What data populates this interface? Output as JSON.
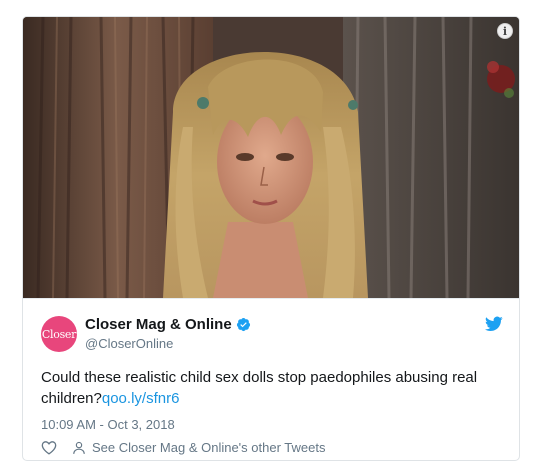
{
  "tweet": {
    "author": {
      "display_name": "Closer Mag & Online",
      "handle": "@CloserOnline",
      "avatar_text": "Closer",
      "verified": true,
      "avatar_color": "#e8467c"
    },
    "text": "Could these realistic child sex dolls stop paedophiles abusing real children?",
    "link": "qoo.ly/sfnr6",
    "timestamp": "10:09 AM - Oct 3, 2018",
    "see_other_label": "See Closer Mag & Online's other Tweets"
  },
  "media": {
    "info_icon": "i",
    "description_icon": "photo"
  },
  "colors": {
    "link": "#1b95e0",
    "twitter_blue": "#1da1f2",
    "secondary_text": "#657786",
    "primary_text": "#14171a"
  },
  "icons": [
    "info-icon",
    "verified-icon",
    "twitter-bird-icon",
    "heart-icon",
    "person-icon"
  ]
}
